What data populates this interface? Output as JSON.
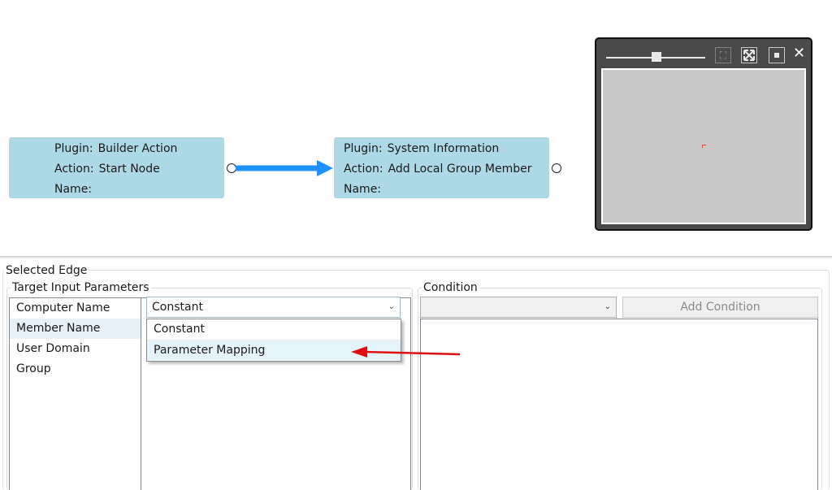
{
  "canvas": {
    "nodes": [
      {
        "plugin_label": "Plugin:",
        "plugin_value": "Builder Action",
        "action_label": "Action:",
        "action_value": "Start Node",
        "name_label": "Name:",
        "name_value": ""
      },
      {
        "plugin_label": "Plugin:",
        "plugin_value": "System Information",
        "action_label": "Action:",
        "action_value": "Add Local Group Member",
        "name_label": "Name:",
        "name_value": ""
      }
    ],
    "node_color": "#add8e6",
    "edge_color": "#1e90ff"
  },
  "minimap": {
    "zoom_level": 0.55,
    "buttons": [
      "fit-icon",
      "expand-icon",
      "center-icon",
      "close-icon"
    ],
    "close_glyph": "✕"
  },
  "selected_edge": {
    "title": "Selected Edge",
    "target_input": {
      "title": "Target Input Parameters",
      "parameters": [
        "Computer Name",
        "Member Name",
        "User Domain",
        "Group"
      ],
      "selected_index": 1,
      "mapping_type": {
        "value": "Constant",
        "options": [
          "Constant",
          "Parameter Mapping"
        ],
        "hover_index": 1
      }
    },
    "condition": {
      "title": "Condition",
      "combo_value": "",
      "add_button_label": "Add Condition"
    }
  },
  "annotation": {
    "arrow_color": "#e01010"
  }
}
